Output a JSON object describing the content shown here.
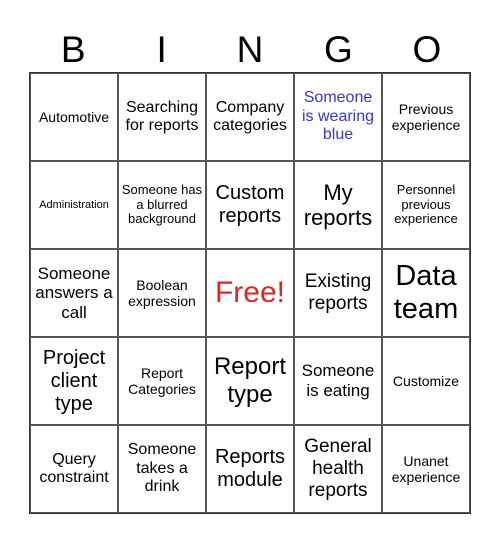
{
  "header": {
    "letters": [
      "B",
      "I",
      "N",
      "G",
      "O"
    ]
  },
  "colors": {
    "free": "#d32a2a",
    "highlight_blue": "#3535d8"
  },
  "cells": [
    [
      "Automotive",
      "Searching for reports",
      "Company categories",
      "Someone is wearing blue",
      "Previous experience"
    ],
    [
      "Administration",
      "Someone has a blurred background",
      "Custom reports",
      "My reports",
      "Personnel previous experience"
    ],
    [
      "Someone answers a call",
      "Boolean expression",
      "Free!",
      "Existing reports",
      "Data team"
    ],
    [
      "Project client type",
      "Report Categories",
      "Report type",
      "Someone is eating",
      "Customize"
    ],
    [
      "Query constraint",
      "Someone takes a drink",
      "Reports module",
      "General health reports",
      "Unanet experience"
    ]
  ]
}
